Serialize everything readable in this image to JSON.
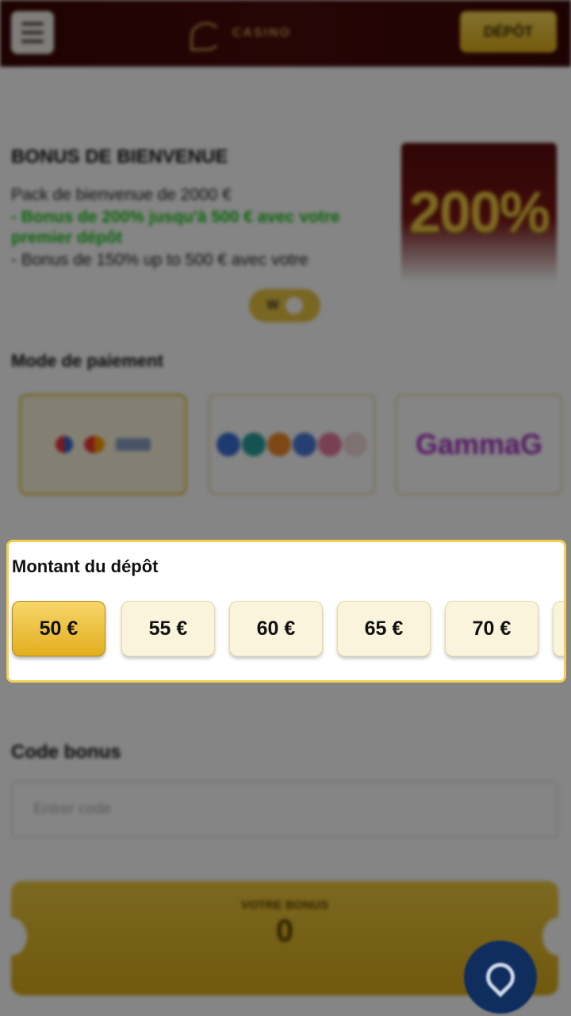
{
  "header": {
    "menu_icon": "hamburger-menu-icon",
    "logo_text": "CASINO",
    "deposit_button": "DÉPÔT"
  },
  "bonus": {
    "title": "BONUS DE BIENVENUE",
    "line1": "Pack de bienvenue de 2000 €",
    "line2": "- Bonus de 200% jusqu'à 500 € avec votre",
    "line3": "premier dépôt",
    "line4": "- Bonus de 150% up to 500 € avec votre",
    "banner": "200%",
    "toggle_label": "W"
  },
  "payment": {
    "title": "Mode de paiement",
    "methods": [
      {
        "name": "cards",
        "selected": true
      },
      {
        "name": "crypto",
        "selected": false
      },
      {
        "name": "GammaG",
        "label": "GammaG",
        "selected": false
      }
    ]
  },
  "deposit_amount": {
    "title": "Montant du dépôt",
    "amounts": [
      "50 €",
      "55 €",
      "60 €",
      "65 €",
      "70 €"
    ],
    "selected_index": 0
  },
  "bonus_code": {
    "title": "Code bonus",
    "placeholder": "Entrer code"
  },
  "ticket": {
    "label": "VOTRE BONUS",
    "value": "0"
  },
  "colors": {
    "accent": "#f2cf52",
    "header_bg": "#4a0a0a",
    "chat_button": "#0f2e5e"
  }
}
